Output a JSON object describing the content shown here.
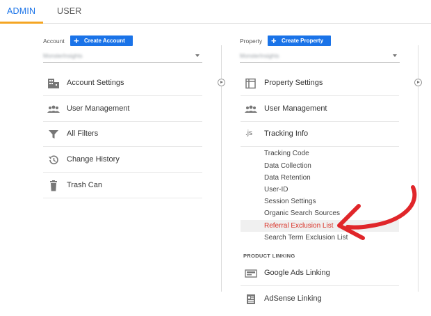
{
  "tabs": {
    "admin": "ADMIN",
    "user": "USER"
  },
  "account": {
    "label": "Account",
    "create_label": "Create Account",
    "selected": "MonsterInsights",
    "menu": [
      {
        "label": "Account Settings",
        "icon": "building-icon"
      },
      {
        "label": "User Management",
        "icon": "people-icon"
      },
      {
        "label": "All Filters",
        "icon": "filter-icon"
      },
      {
        "label": "Change History",
        "icon": "history-icon"
      },
      {
        "label": "Trash Can",
        "icon": "trash-icon"
      }
    ]
  },
  "property": {
    "label": "Property",
    "create_label": "Create Property",
    "selected": "MonsterInsights",
    "menu": [
      {
        "label": "Property Settings",
        "icon": "property-icon"
      },
      {
        "label": "User Management",
        "icon": "people-icon"
      },
      {
        "label": "Tracking Info",
        "icon": "js-icon",
        "icon_text": ".js"
      }
    ],
    "tracking_sub": [
      "Tracking Code",
      "Data Collection",
      "Data Retention",
      "User-ID",
      "Session Settings",
      "Organic Search Sources",
      "Referral Exclusion List",
      "Search Term Exclusion List"
    ],
    "active_sub": "Referral Exclusion List",
    "product_linking_header": "PRODUCT LINKING",
    "linking": [
      {
        "label": "Google Ads Linking",
        "icon": "ads-icon"
      },
      {
        "label": "AdSense Linking",
        "icon": "adsense-icon"
      }
    ]
  },
  "colors": {
    "primary": "#1a73e8",
    "tab_indicator": "#f4a523",
    "active_link": "#d93025",
    "annotation_arrow": "#e0262a"
  }
}
